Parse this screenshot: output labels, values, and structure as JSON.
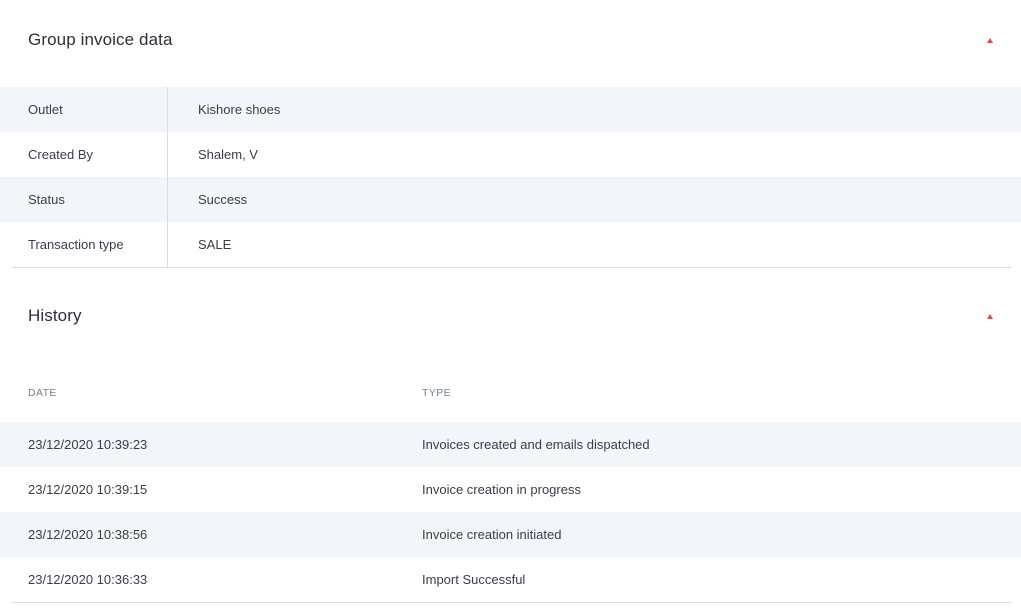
{
  "group_invoice": {
    "title": "Group invoice data",
    "rows": [
      {
        "label": "Outlet",
        "value": "Kishore shoes"
      },
      {
        "label": "Created By",
        "value": "Shalem, V"
      },
      {
        "label": "Status",
        "value": "Success"
      },
      {
        "label": "Transaction type",
        "value": "SALE"
      }
    ]
  },
  "history": {
    "title": "History",
    "columns": {
      "date": "DATE",
      "type": "TYPE"
    },
    "rows": [
      {
        "date": "23/12/2020 10:39:23",
        "type": "Invoices created and emails dispatched"
      },
      {
        "date": "23/12/2020 10:39:15",
        "type": "Invoice creation in progress"
      },
      {
        "date": "23/12/2020 10:38:56",
        "type": "Invoice creation initiated"
      },
      {
        "date": "23/12/2020 10:36:33",
        "type": "Import Successful"
      }
    ]
  },
  "colors": {
    "accent": "#e8434b",
    "row_shade": "#f4f5f8",
    "divider": "#dcdde2"
  },
  "icons": {
    "collapse": "caret-up-icon"
  }
}
